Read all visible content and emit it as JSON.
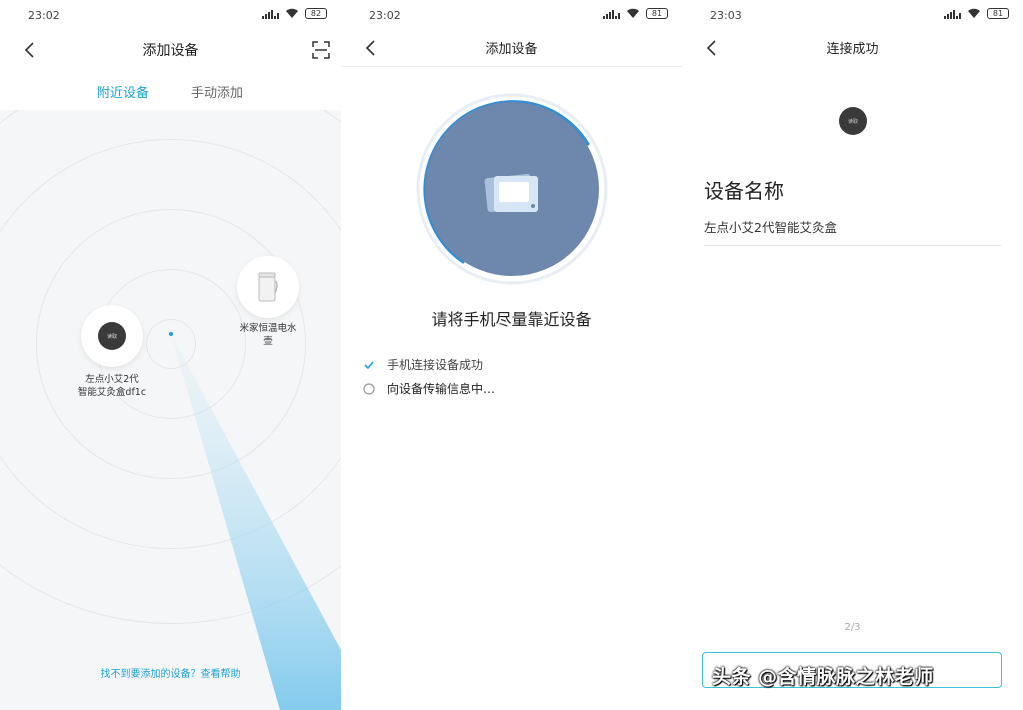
{
  "screen1": {
    "status": {
      "time": "23:02",
      "battery": "82"
    },
    "nav_title": "添加设备",
    "tabs": [
      {
        "label": "附近设备",
        "active": true
      },
      {
        "label": "手动添加",
        "active": false
      }
    ],
    "devices": [
      {
        "label_line1": "左点小艾2代",
        "label_line2": "智能艾灸盒df1c",
        "icon": "moxibustion-box-icon",
        "screen_text": "读取"
      },
      {
        "label_line1": "米家恒温电水",
        "label_line2": "壶",
        "icon": "kettle-icon"
      }
    ],
    "help_link": "找不到要添加的设备？查看帮助",
    "accent_color": "#1ba3d6"
  },
  "screen2": {
    "status": {
      "time": "23:02",
      "battery": "81"
    },
    "nav_title": "添加设备",
    "instruction": "请将手机尽量靠近设备",
    "steps": [
      {
        "label": "手机连接设备成功",
        "state": "done"
      },
      {
        "label": "向设备传输信息中…",
        "state": "loading"
      }
    ],
    "circle_color": "#6e88ad"
  },
  "screen3": {
    "status": {
      "time": "23:03",
      "battery": "81"
    },
    "nav_title": "连接成功",
    "device_screen_text": "读取",
    "heading": "设备名称",
    "device_name": "左点小艾2代智能艾灸盒",
    "page_indicator": "2/3",
    "button_border_color": "#39c4d7"
  },
  "watermark": "头条 @含情脉脉之林老师"
}
